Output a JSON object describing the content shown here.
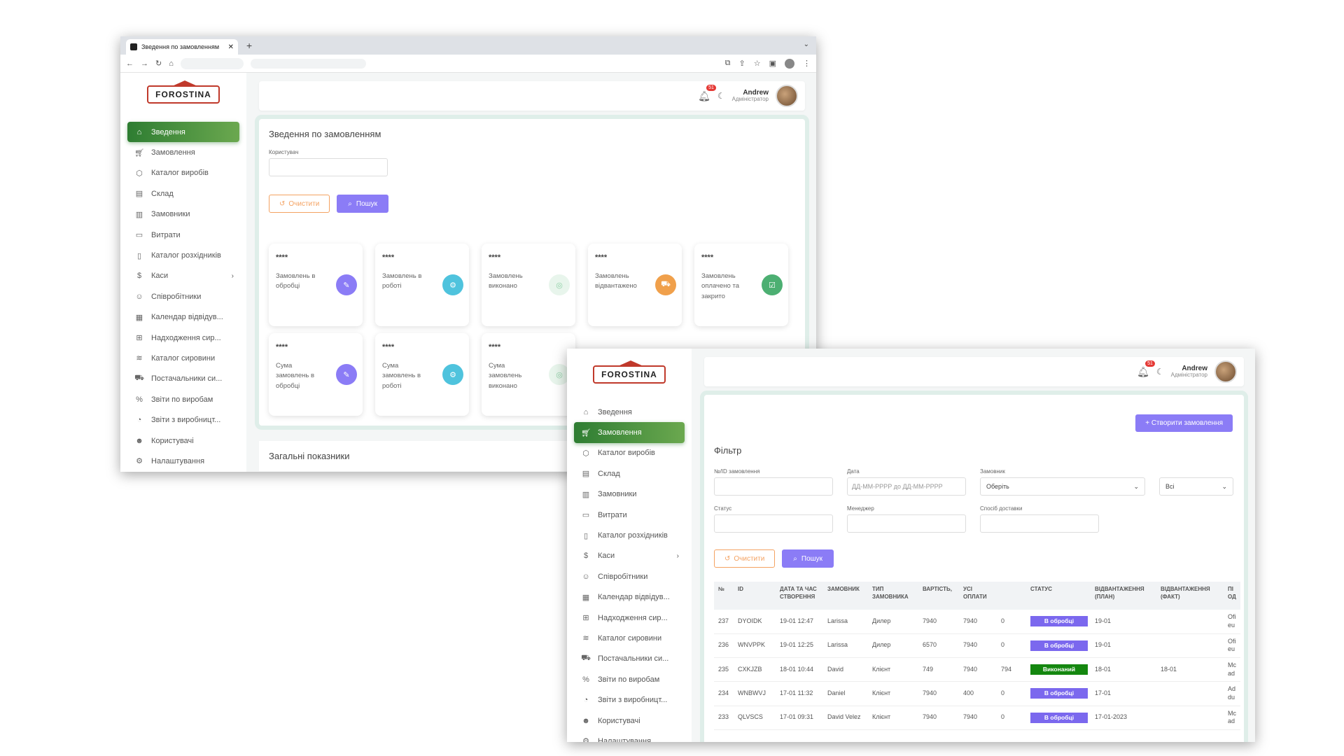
{
  "browser": {
    "tab_title": "Зведення по замовленням",
    "tab_close": "✕",
    "new_tab": "+",
    "tab_dropdown": "⌄"
  },
  "brand": {
    "logo_text": "FOROSTINA"
  },
  "nav": [
    {
      "label": "Зведення",
      "icon": "home-icon"
    },
    {
      "label": "Замовлення",
      "icon": "cart-icon"
    },
    {
      "label": "Каталог виробів",
      "icon": "box-icon"
    },
    {
      "label": "Склад",
      "icon": "archive-icon"
    },
    {
      "label": "Замовники",
      "icon": "briefcase-icon"
    },
    {
      "label": "Витрати",
      "icon": "folder-icon"
    },
    {
      "label": "Каталог розхідників",
      "icon": "book-icon"
    },
    {
      "label": "Каси",
      "icon": "dollar-icon"
    },
    {
      "label": "Співробітники",
      "icon": "user-check-icon"
    },
    {
      "label": "Календар відвідув...",
      "icon": "calendar-icon"
    },
    {
      "label": "Надходження сир...",
      "icon": "folder-plus-icon"
    },
    {
      "label": "Каталог сировини",
      "icon": "layers-icon"
    },
    {
      "label": "Постачальники си...",
      "icon": "truck-icon"
    },
    {
      "label": "Звіти по виробам",
      "icon": "percent-icon"
    },
    {
      "label": "Звіти з виробницт...",
      "icon": "pie-chart-icon"
    },
    {
      "label": "Користувачі",
      "icon": "users-icon"
    },
    {
      "label": "Налаштування",
      "icon": "settings-icon"
    }
  ],
  "header": {
    "notifications": "51",
    "user_name": "Andrew",
    "user_role": "Адміністратор"
  },
  "dashboard": {
    "title": "Зведення по замовленням",
    "user_label": "Користувач",
    "clear_label": "Очистити",
    "search_label": "Пошук",
    "stats_row1": [
      {
        "value": "****",
        "title": "Замовлень в обробці",
        "color": "#8b7cf6",
        "icon": "✎"
      },
      {
        "value": "****",
        "title": "Замовлень в роботі",
        "color": "#4fc3dd",
        "icon": "⚙"
      },
      {
        "value": "****",
        "title": "Замовлень виконано",
        "color": "#e8f5ec",
        "icon": "◎"
      },
      {
        "value": "****",
        "title": "Замовлень відвантажено",
        "color": "#f0a04b",
        "icon": "⛟"
      },
      {
        "value": "****",
        "title": "Замовлень оплачено та закрито",
        "color": "#4caf72",
        "icon": "☑"
      }
    ],
    "stats_row2": [
      {
        "value": "****",
        "title": "Сума замовлень в обробці",
        "color": "#8b7cf6",
        "icon": "✎"
      },
      {
        "value": "****",
        "title": "Сума замовлень в роботі",
        "color": "#4fc3dd",
        "icon": "⚙"
      },
      {
        "value": "****",
        "title": "Сума замовлень виконано",
        "color": "#e8f5ec",
        "icon": "◎"
      }
    ],
    "section2_title": "Загальні показники"
  },
  "orders": {
    "create_label": "+ Створити замовлення",
    "filter_title": "Фільтр",
    "f_id_label": "№/ID замовлення",
    "f_date_label": "Дата",
    "f_date_placeholder": "ДД-ММ-РРРР до ДД-ММ-РРРР",
    "f_customer_label": "Замовник",
    "f_customer_value": "Оберіть",
    "f_all_value": "Всі",
    "f_status_label": "Статус",
    "f_manager_label": "Менеджер",
    "f_delivery_label": "Спосіб доставки",
    "clear_label": "Очистити",
    "search_label": "Пошук",
    "columns": [
      "№",
      "ID",
      "Дата та час створення",
      "Замовник",
      "Тип замовника",
      "Вартість,",
      "Усі оплати",
      "",
      "Статус",
      "Відвантаження (план)",
      "Відвантаження (факт)",
      "Пі од"
    ],
    "rows": [
      [
        "237",
        "DYOIDK",
        "19-01 12:47",
        "Larissa",
        "Дилер",
        "7940",
        "7940",
        "0",
        "В обробці",
        "19-01",
        "",
        "Ofi eu"
      ],
      [
        "236",
        "WNVPPK",
        "19-01 12:25",
        "Larissa",
        "Дилер",
        "6570",
        "7940",
        "0",
        "В обробці",
        "19-01",
        "",
        "Ofi eu"
      ],
      [
        "235",
        "CXKJZB",
        "18-01 10:44",
        "David",
        "Клієнт",
        "749",
        "7940",
        "794",
        "Виконаний",
        "18-01",
        "18-01",
        "Mc ad"
      ],
      [
        "234",
        "WNBWVJ",
        "17-01 11:32",
        "Daniel",
        "Клієнт",
        "7940",
        "400",
        "0",
        "В обробці",
        "17-01",
        "",
        "Ad du"
      ],
      [
        "233",
        "QLVSCS",
        "17-01 09:31",
        "David Velez",
        "Клієнт",
        "7940",
        "7940",
        "0",
        "В обробці",
        "17-01-2023",
        "",
        "Mc ad"
      ]
    ]
  }
}
